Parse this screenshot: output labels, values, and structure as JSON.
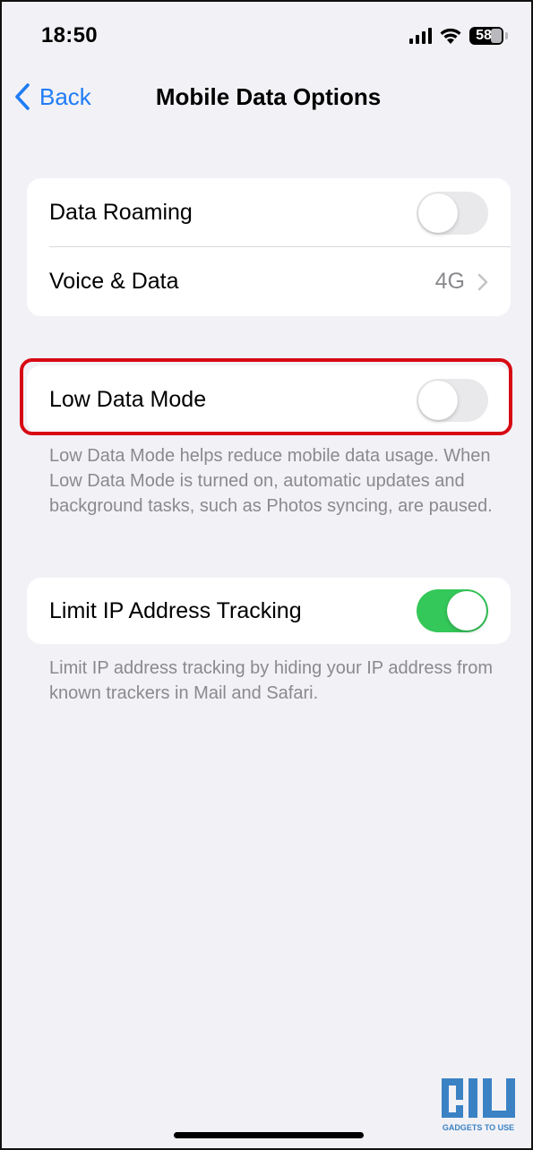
{
  "status_bar": {
    "time": "18:50",
    "battery": "58",
    "signal_icon": "signal-bars-icon",
    "wifi_icon": "wifi-icon",
    "battery_icon": "battery-icon"
  },
  "nav": {
    "back_label": "Back",
    "back_icon": "chevron-left-icon",
    "title": "Mobile Data Options"
  },
  "group1": {
    "data_roaming": {
      "label": "Data Roaming",
      "toggle_on": false
    },
    "voice_data": {
      "label": "Voice & Data",
      "value": "4G",
      "icon": "chevron-right-icon"
    }
  },
  "group2": {
    "low_data_mode": {
      "label": "Low Data Mode",
      "toggle_on": false
    },
    "footnote": "Low Data Mode helps reduce mobile data usage. When Low Data Mode is turned on, automatic updates and background tasks, such as Photos syncing, are paused."
  },
  "group3": {
    "limit_ip": {
      "label": "Limit IP Address Tracking",
      "toggle_on": true
    },
    "footnote": "Limit IP address tracking by hiding your IP address from known trackers in Mail and Safari."
  },
  "watermark": {
    "text": "GADGETS TO USE"
  },
  "colors": {
    "accent": "#1f7cf6",
    "toggle_on": "#34c759",
    "highlight": "#d70a14",
    "background": "#f2f2f6"
  }
}
